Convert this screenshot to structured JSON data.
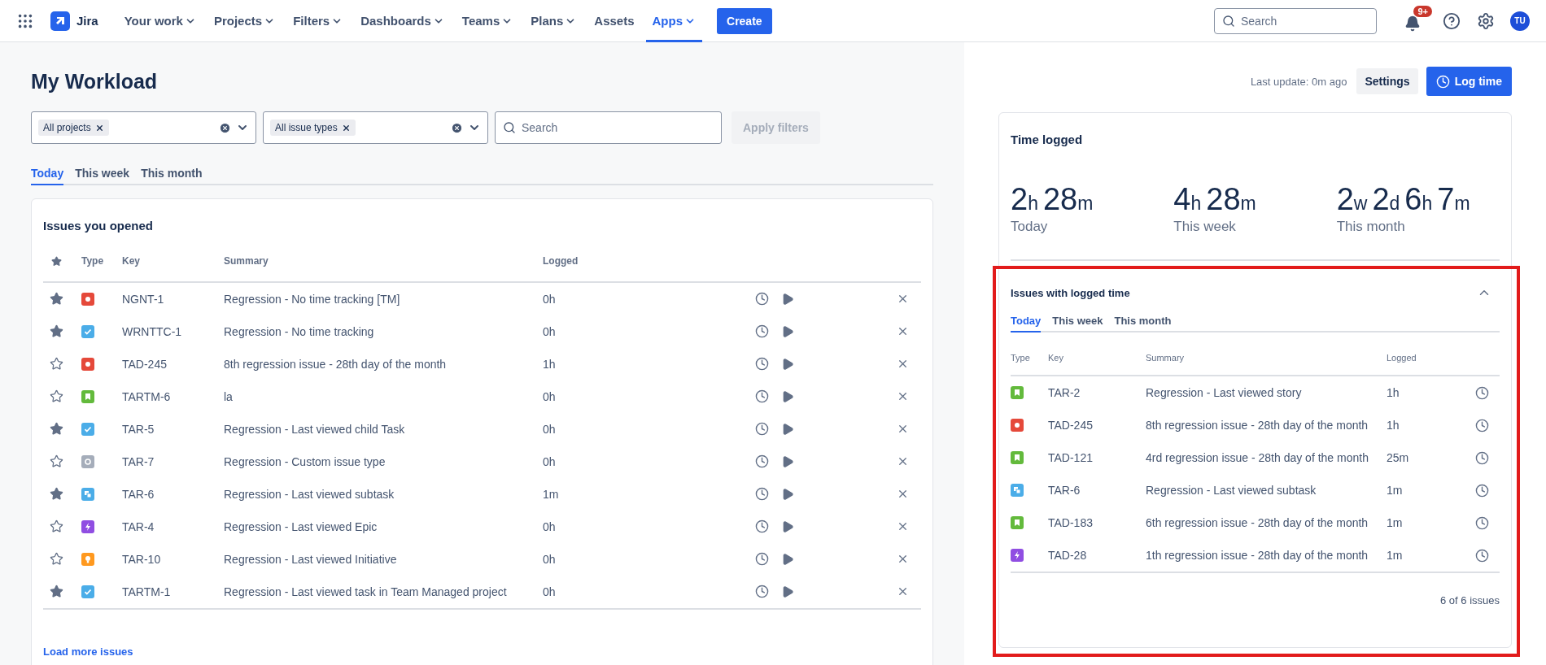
{
  "nav": {
    "product": "Jira",
    "items": [
      {
        "label": "Your work",
        "has_menu": true,
        "selected": false
      },
      {
        "label": "Projects",
        "has_menu": true,
        "selected": false
      },
      {
        "label": "Filters",
        "has_menu": true,
        "selected": false
      },
      {
        "label": "Dashboards",
        "has_menu": true,
        "selected": false
      },
      {
        "label": "Teams",
        "has_menu": true,
        "selected": false
      },
      {
        "label": "Plans",
        "has_menu": true,
        "selected": false
      },
      {
        "label": "Assets",
        "has_menu": false,
        "selected": false
      },
      {
        "label": "Apps",
        "has_menu": true,
        "selected": true
      }
    ],
    "create": "Create",
    "search": {
      "placeholder": "Search"
    },
    "notifications": "9+",
    "avatar": "TU"
  },
  "page": {
    "title": "My Workload",
    "filters": [
      {
        "chip": "All projects"
      },
      {
        "chip": "All issue types"
      }
    ],
    "search": {
      "placeholder": "Search"
    },
    "apply": {
      "label": "Apply filters",
      "disabled": true
    },
    "tabs": [
      {
        "label": "Today",
        "selected": true
      },
      {
        "label": "This week",
        "selected": false
      },
      {
        "label": "This month",
        "selected": false
      }
    ],
    "opened": {
      "title": "Issues you opened",
      "columns": [
        "Type",
        "Key",
        "Summary",
        "Logged"
      ],
      "rows": [
        {
          "starred": true,
          "kind": "bug",
          "key": "NGNT-1",
          "summary": "Regression - No time tracking [TM]",
          "logged": "0h"
        },
        {
          "starred": true,
          "kind": "task",
          "key": "WRNTTC-1",
          "summary": "Regression - No time tracking",
          "logged": "0h"
        },
        {
          "starred": false,
          "kind": "bug",
          "key": "TAD-245",
          "summary": "8th regression issue - 28th day of the month",
          "logged": "1h"
        },
        {
          "starred": false,
          "kind": "story",
          "key": "TARTM-6",
          "summary": "la",
          "logged": "0h"
        },
        {
          "starred": true,
          "kind": "task",
          "key": "TAR-5",
          "summary": "Regression - Last viewed child Task",
          "logged": "0h"
        },
        {
          "starred": false,
          "kind": "custom",
          "key": "TAR-7",
          "summary": "Regression - Custom issue type",
          "logged": "0h"
        },
        {
          "starred": true,
          "kind": "subtask",
          "key": "TAR-6",
          "summary": "Regression - Last viewed subtask",
          "logged": "1m"
        },
        {
          "starred": false,
          "kind": "epic",
          "key": "TAR-4",
          "summary": "Regression - Last viewed Epic",
          "logged": "0h"
        },
        {
          "starred": false,
          "kind": "initiative",
          "key": "TAR-10",
          "summary": "Regression - Last viewed Initiative",
          "logged": "0h"
        },
        {
          "starred": true,
          "kind": "task",
          "key": "TARTM-1",
          "summary": "Regression - Last viewed task in Team Managed project",
          "logged": "0h"
        }
      ],
      "load_more": "Load more issues"
    }
  },
  "side": {
    "last_update": "Last update: 0m ago",
    "settings": "Settings",
    "log_time": "Log time",
    "time_logged": {
      "title": "Time logged",
      "totals": [
        {
          "parts": [
            {
              "value": "2",
              "unit": "h"
            },
            {
              "value": "28",
              "unit": "m"
            }
          ],
          "label": "Today"
        },
        {
          "parts": [
            {
              "value": "4",
              "unit": "h"
            },
            {
              "value": "28",
              "unit": "m"
            }
          ],
          "label": "This week"
        },
        {
          "parts": [
            {
              "value": "2",
              "unit": "w"
            },
            {
              "value": "2",
              "unit": "d"
            },
            {
              "value": "6",
              "unit": "h"
            },
            {
              "value": "7",
              "unit": "m"
            }
          ],
          "label": "This month"
        }
      ]
    },
    "logged_issues": {
      "title": "Issues with logged time",
      "expanded": true,
      "highlight": {
        "kind": "frame"
      },
      "tabs": [
        {
          "label": "Today",
          "selected": true
        },
        {
          "label": "This week",
          "selected": false
        },
        {
          "label": "This month",
          "selected": false
        }
      ],
      "columns": [
        "Type",
        "Key",
        "Summary",
        "Logged"
      ],
      "rows": [
        {
          "kind": "story",
          "key": "TAR-2",
          "summary": "Regression - Last viewed story",
          "logged": "1h"
        },
        {
          "kind": "bug",
          "key": "TAD-245",
          "summary": "8th regression issue - 28th day of the month",
          "logged": "1h"
        },
        {
          "kind": "story",
          "key": "TAD-121",
          "summary": "4rd regression issue - 28th day of the month",
          "logged": "25m"
        },
        {
          "kind": "subtask",
          "key": "TAR-6",
          "summary": "Regression - Last viewed subtask",
          "logged": "1m"
        },
        {
          "kind": "story",
          "key": "TAD-183",
          "summary": "6th regression issue - 28th day of the month",
          "logged": "1m"
        },
        {
          "kind": "epic",
          "key": "TAD-28",
          "summary": "1th regression issue - 28th day of the month",
          "logged": "1m"
        }
      ],
      "count": "6 of 6 issues"
    }
  }
}
